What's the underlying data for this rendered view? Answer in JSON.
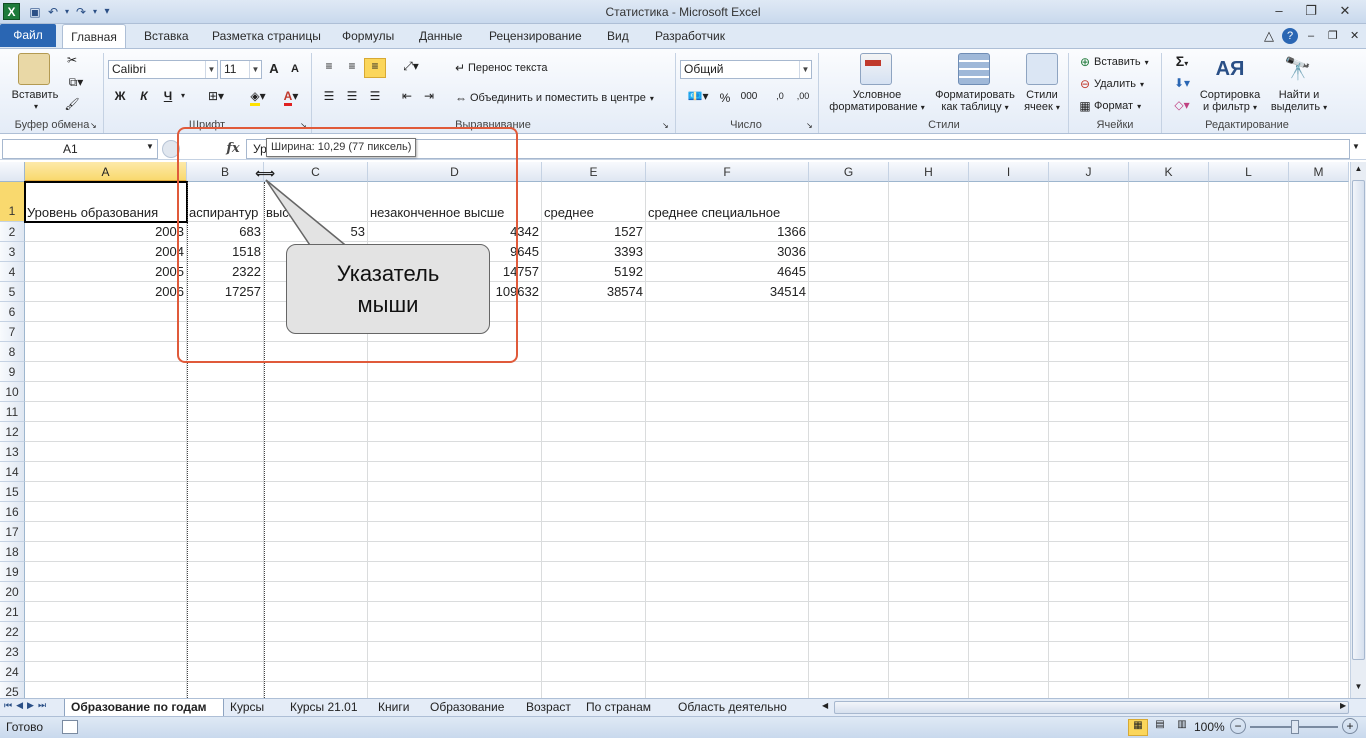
{
  "window": {
    "title": "Статистика - Microsoft Excel",
    "minimize": "‒",
    "restore": "❐",
    "close": "✕"
  },
  "ribbon_tabs": [
    "Файл",
    "Главная",
    "Вставка",
    "Разметка страницы",
    "Формулы",
    "Данные",
    "Рецензирование",
    "Вид",
    "Разработчик"
  ],
  "ribbon": {
    "clipboard": {
      "paste": "Вставить",
      "label": "Буфер обмена"
    },
    "font": {
      "name": "Calibri",
      "size": "11",
      "bold": "Ж",
      "italic": "К",
      "underline": "Ч",
      "grow": "A",
      "shrink": "A",
      "color_letter": "A",
      "label": "Шрифт"
    },
    "alignment": {
      "wrap": "Перенос текста",
      "merge": "Объединить и поместить в центре",
      "label": "Выравнивание"
    },
    "number": {
      "format": "Общий",
      "percent": "%",
      "thousands": "000",
      "inc_dec": ",0",
      "dec_dec": ",00",
      "label": "Число"
    },
    "styles": {
      "conditional": "Условное\nформатирование",
      "cond_l1": "Условное",
      "cond_l2": "форматирование",
      "table_l1": "Форматировать",
      "table_l2": "как таблицу",
      "cell_l1": "Стили",
      "cell_l2": "ячеек",
      "label": "Стили"
    },
    "cells": {
      "insert": "Вставить",
      "delete": "Удалить",
      "format": "Формат",
      "label": "Ячейки"
    },
    "editing": {
      "sum": "Σ",
      "sort_l1": "Сортировка",
      "sort_l2": "и фильтр",
      "find_l1": "Найти и",
      "find_l2": "выделить",
      "label": "Редактирование"
    }
  },
  "formula_bar": {
    "name_box": "A1",
    "fx": "fx",
    "content": "Ур"
  },
  "tooltip": "Ширина: 10,29 (77 пиксель)",
  "columns": [
    "A",
    "B",
    "C",
    "D",
    "E",
    "F",
    "G",
    "H",
    "I",
    "J",
    "K",
    "L",
    "M"
  ],
  "rows": [
    "1",
    "2",
    "3",
    "4",
    "5",
    "6",
    "7",
    "8",
    "9",
    "10",
    "11",
    "12",
    "13",
    "14",
    "15",
    "16",
    "17",
    "18",
    "19",
    "20",
    "21",
    "22",
    "23",
    "24",
    "25"
  ],
  "headers_row": {
    "A": "Уровень образования",
    "B": "аспирантур",
    "C": "высш",
    "D": "незаконченное высше",
    "E": "среднее",
    "F": "среднее специальное"
  },
  "data_rows": [
    {
      "A": "2003",
      "B": "683",
      "C": "53",
      "D": "4342",
      "E": "1527",
      "F": "1366"
    },
    {
      "A": "2004",
      "B": "1518",
      "C": "",
      "D": "9645",
      "E": "3393",
      "F": "3036"
    },
    {
      "A": "2005",
      "B": "2322",
      "C": "",
      "D": "14757",
      "E": "5192",
      "F": "4645"
    },
    {
      "A": "2006",
      "B": "17257",
      "C": "",
      "D": "109632",
      "E": "38574",
      "F": "34514"
    }
  ],
  "callout": {
    "line1": "Указатель",
    "line2": "мыши"
  },
  "sheet_tabs": [
    "Образование по годам",
    "Курсы",
    "Курсы 21.01",
    "Книги",
    "Образование",
    "Возраст",
    "По странам",
    "Область деятельно"
  ],
  "status": {
    "ready": "Готово",
    "zoom": "100%",
    "zoom_out": "−",
    "zoom_in": "+"
  }
}
